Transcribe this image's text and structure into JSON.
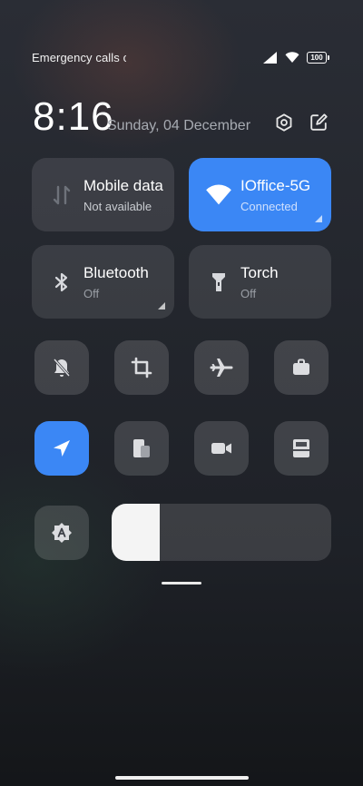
{
  "status_bar": {
    "text": "Emergency calls only",
    "battery": "100",
    "icons": [
      "signal-icon",
      "wifi-icon",
      "battery-icon"
    ]
  },
  "header": {
    "time": "8:16",
    "date": "Sunday, 04 December"
  },
  "tiles": {
    "mobile_data": {
      "title": "Mobile data",
      "subtitle": "Not available",
      "active": false
    },
    "wifi": {
      "title": "IOffice-5G",
      "subtitle": "Connected",
      "active": true
    },
    "bluetooth": {
      "title": "Bluetooth",
      "subtitle": "Off",
      "active": false
    },
    "torch": {
      "title": "Torch",
      "subtitle": "Off",
      "active": false
    }
  },
  "quick_toggles": [
    {
      "icon": "mute-bell-icon",
      "on": false
    },
    {
      "icon": "crop-icon",
      "on": false
    },
    {
      "icon": "airplane-icon",
      "on": false
    },
    {
      "icon": "briefcase-icon",
      "on": false
    },
    {
      "icon": "location-icon",
      "on": true
    },
    {
      "icon": "cast-icon",
      "on": false
    },
    {
      "icon": "video-camera-icon",
      "on": false
    },
    {
      "icon": "reading-mode-icon",
      "on": false
    }
  ],
  "brightness": {
    "level": 0.22,
    "auto_icon": "auto-brightness-icon"
  },
  "colors": {
    "accent": "#3b87f5",
    "tile_bg": "rgba(255,255,255,0.10)"
  }
}
